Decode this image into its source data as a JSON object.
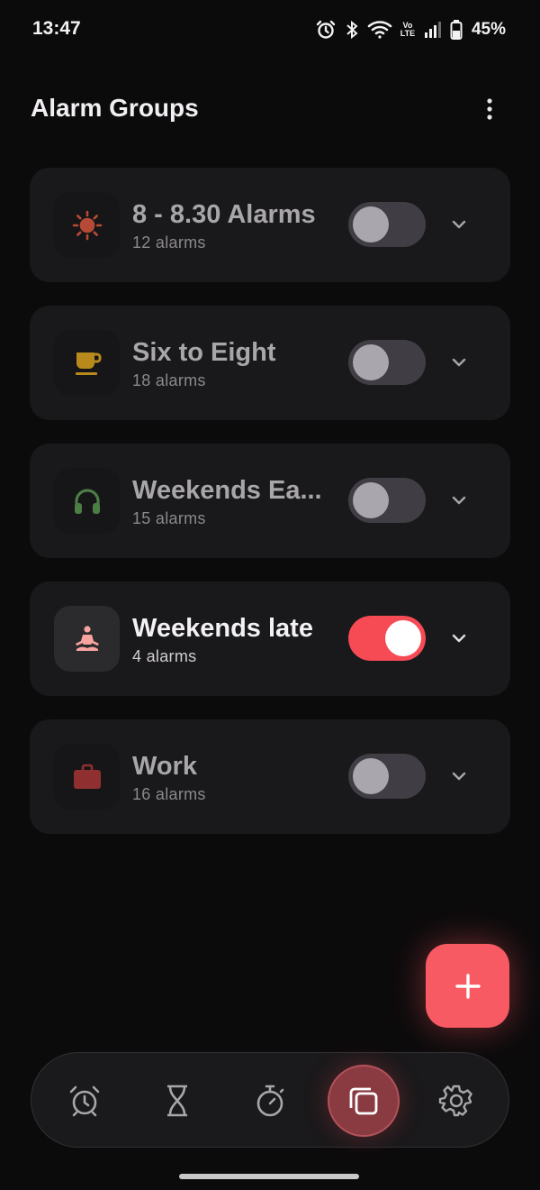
{
  "status_bar": {
    "time": "13:47",
    "network_badge_top": "Vo",
    "network_badge_bottom": "LTE",
    "battery_percent": "45%",
    "icons": [
      "alarm-icon",
      "bluetooth-icon",
      "wifi-icon",
      "volte-icon",
      "signal-icon",
      "battery-icon"
    ]
  },
  "header": {
    "title": "Alarm Groups",
    "menu_icon": "more-vert-icon"
  },
  "groups": [
    {
      "name": "8 - 8.30 Alarms",
      "count": "12 alarms",
      "icon": "sun-icon",
      "icon_color": "#b74a36",
      "enabled": false
    },
    {
      "name": "Six to Eight",
      "count": "18 alarms",
      "icon": "coffee-icon",
      "icon_color": "#b88a1c",
      "enabled": false
    },
    {
      "name": "Weekends Ea...",
      "count": "15 alarms",
      "icon": "headphones-icon",
      "icon_color": "#4b7d45",
      "enabled": false
    },
    {
      "name": "Weekends late",
      "count": "4 alarms",
      "icon": "meditation-icon",
      "icon_color": "#f7a3a0",
      "enabled": true
    },
    {
      "name": "Work",
      "count": "16 alarms",
      "icon": "briefcase-icon",
      "icon_color": "#8f2f30",
      "enabled": false
    }
  ],
  "fab": {
    "icon": "plus-icon"
  },
  "bottom_nav": [
    {
      "name": "alarm",
      "icon": "alarm-clock-icon",
      "active": false
    },
    {
      "name": "timer",
      "icon": "hourglass-icon",
      "active": false
    },
    {
      "name": "stopwatch",
      "icon": "stopwatch-icon",
      "active": false
    },
    {
      "name": "groups",
      "icon": "copy-squares-icon",
      "active": true
    },
    {
      "name": "settings",
      "icon": "gear-icon",
      "active": false
    }
  ],
  "colors": {
    "background": "#0c0b0c",
    "card": "#19181a",
    "accent": "#f64a55",
    "toggle_off_track": "#403e44"
  }
}
